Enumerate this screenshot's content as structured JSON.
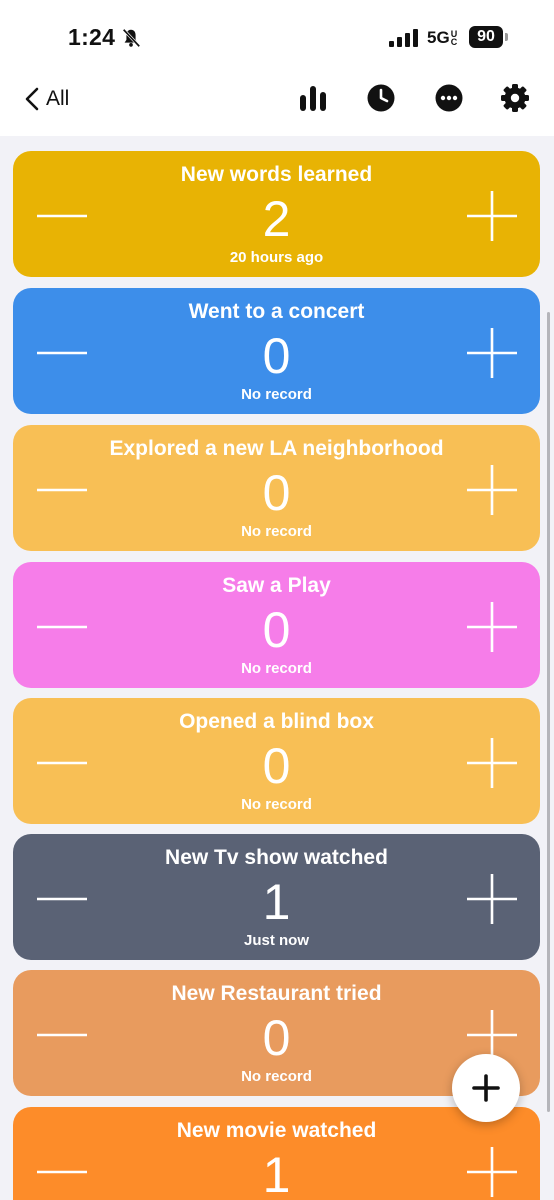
{
  "status_bar": {
    "time": "1:24",
    "network": "5G",
    "network_suffix": "UC",
    "battery": "90"
  },
  "nav": {
    "back_label": "All",
    "icons": [
      "bar-chart-icon",
      "clock-icon",
      "more-icon",
      "gear-icon"
    ]
  },
  "counters": [
    {
      "title": "New words learned",
      "count": "2",
      "subtitle": "20 hours ago",
      "color": "#e8b304"
    },
    {
      "title": "Went to a concert",
      "count": "0",
      "subtitle": "No record",
      "color": "#3d8eea"
    },
    {
      "title": "Explored a new LA neighborhood",
      "count": "0",
      "subtitle": "No record",
      "color": "#f8bf55"
    },
    {
      "title": "Saw a Play",
      "count": "0",
      "subtitle": "No record",
      "color": "#f67de9"
    },
    {
      "title": "Opened a blind box",
      "count": "0",
      "subtitle": "No record",
      "color": "#f8bf55"
    },
    {
      "title": "New Tv show watched",
      "count": "1",
      "subtitle": "Just now",
      "color": "#5a6275"
    },
    {
      "title": "New Restaurant tried",
      "count": "0",
      "subtitle": "No record",
      "color": "#e89b5e"
    },
    {
      "title": "New movie watched",
      "count": "1",
      "subtitle": "",
      "color": "#fd8c29"
    }
  ]
}
